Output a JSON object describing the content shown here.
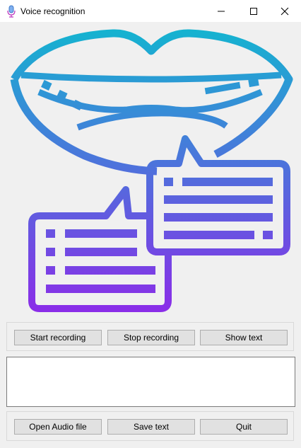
{
  "window": {
    "title": "Voice recognition",
    "app_icon": "microphone-icon",
    "controls": [
      "minimize-icon",
      "maximize-icon",
      "close-icon"
    ]
  },
  "illustration": {
    "icon": "lips-speech-bubbles-icon",
    "gradient": [
      "#14b4d0",
      "#8a2de8"
    ]
  },
  "controls_top": {
    "start_label": "Start recording",
    "stop_label": "Stop recording",
    "show_label": "Show text"
  },
  "output": {
    "value": ""
  },
  "controls_bottom": {
    "open_label": "Open Audio file",
    "save_label": "Save text",
    "quit_label": "Quit"
  }
}
